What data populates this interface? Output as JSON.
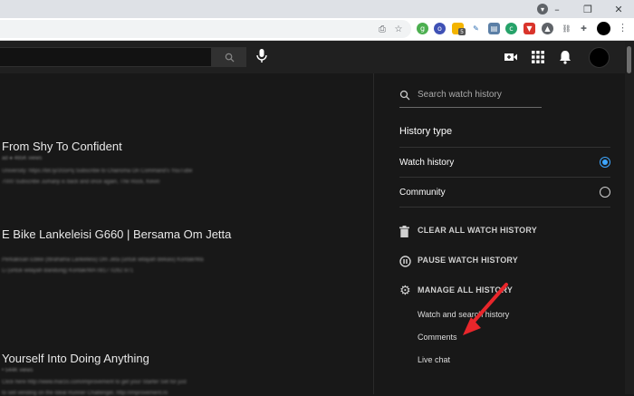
{
  "browser": {
    "tab_dropdown_icon": "chevron-down-icon",
    "window_controls": [
      "–",
      "❐",
      "✕"
    ],
    "toolbar_icons": [
      "install-icon",
      "star-icon",
      "extension-icon",
      "menu-icon"
    ],
    "extension_badge": "5"
  },
  "header": {
    "search_icon": "search-icon",
    "mic_icon": "mic-icon",
    "create_icon": "video-create-icon",
    "apps_icon": "apps-icon",
    "bell_icon": "bell-icon"
  },
  "videos": [
    {
      "title": "From Shy To Confident",
      "meta": "ad  ●  465K views",
      "desc": [
        "University: https://bit.ly/3S5Pq  Subscribe to Charisma On Command's YouTube",
        "7000 Subscribe Jumanji is back and once again, The Rock, Kevin"
      ]
    },
    {
      "title": "E Bike Lankeleisi G660 | Bersama Om Jetta",
      "meta": "",
      "desc": [
        "Perkakisan Ebike (Ibrahama Lankeleisi) Om Jeta (untuk wilayah Bekasi) Kontak/Wa",
        "Li (untuk wilayah Bandung) Kontak/WA 0817 0262 871"
      ]
    },
    {
      "title": "Yourself Into Doing Anything",
      "meta": "• 544K views",
      "desc": [
        "Click here http://www.marzo.com/improvement to get your Starter Set for just",
        "to sell vending on the Ideal Runner Challenger, http://improvement.ro"
      ]
    }
  ],
  "panel": {
    "search_placeholder": "Search watch history",
    "history_type_title": "History type",
    "options": [
      {
        "label": "Watch history",
        "selected": true
      },
      {
        "label": "Community",
        "selected": false
      }
    ],
    "actions": [
      {
        "label": "CLEAR ALL WATCH HISTORY",
        "icon": "trash-icon"
      },
      {
        "label": "PAUSE WATCH HISTORY",
        "icon": "pause-icon"
      },
      {
        "label": "MANAGE ALL HISTORY",
        "icon": "gear-icon"
      }
    ],
    "sub_items": [
      "Watch and search history",
      "Comments",
      "Live chat"
    ]
  },
  "colors": {
    "accent": "#3ea6ff",
    "arrow": "#e8262b"
  }
}
